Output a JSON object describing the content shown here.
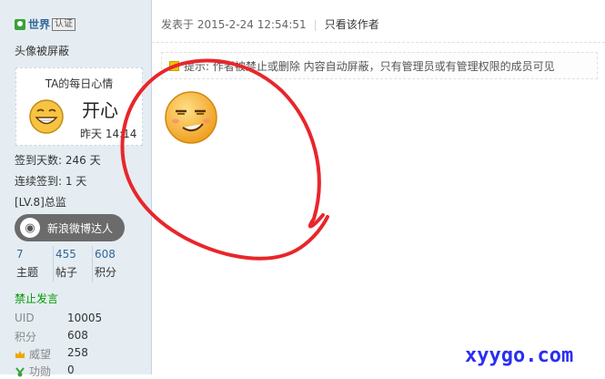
{
  "sidebar": {
    "username": "世界",
    "verify_badge": "认证",
    "avatar_blocked": "头像被屏蔽",
    "mood": {
      "title": "TA的每日心情",
      "value": "开心",
      "time": "昨天 14:14",
      "face_icon": "happy-grin-icon"
    },
    "stats": {
      "signin_days": "签到天数: 246 天",
      "streak": "连续签到: 1 天",
      "level": "[LV.8]总监"
    },
    "weibo": {
      "label": "新浪微博达人",
      "icon": "weibo-icon"
    },
    "counts": [
      {
        "num": "7",
        "label": "主题"
      },
      {
        "num": "455",
        "label": "帖子"
      },
      {
        "num": "608",
        "label": "积分"
      }
    ],
    "ban_status": "禁止发言",
    "info": [
      {
        "key": "UID",
        "value": "10005"
      },
      {
        "key": "积分",
        "value": "608"
      },
      {
        "key": "威望",
        "value": "258",
        "icon": "crown-icon"
      },
      {
        "key": "功勋",
        "value": "0",
        "icon": "medal-icon"
      }
    ]
  },
  "post": {
    "posted_at": "发表于 2015-2-24 12:54:51",
    "only_author": "只看该作者",
    "notice": "提示: 作者被禁止或删除 内容自动屏蔽，只有管理员或有管理权限的成员可见",
    "emoji_icon": "smug-face-icon"
  },
  "watermark": "xyygo.com",
  "colors": {
    "link_blue": "#336699",
    "sidebar_bg": "#e5edf2",
    "ban_green": "#009900",
    "scribble_red": "#e8262b"
  }
}
